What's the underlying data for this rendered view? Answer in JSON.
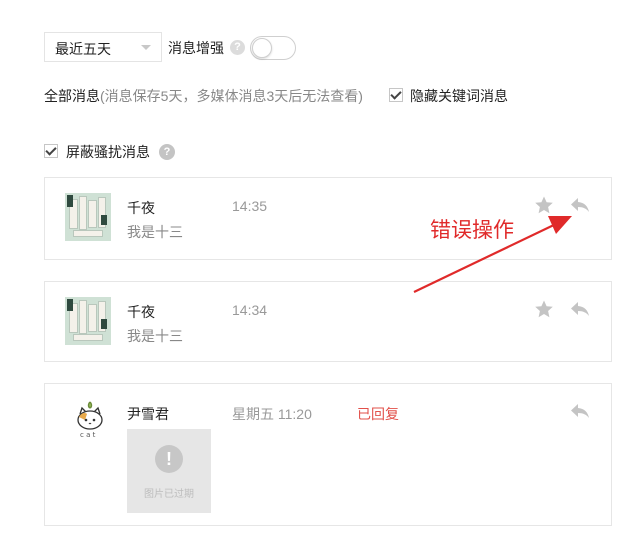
{
  "filter": {
    "selected": "最近五天"
  },
  "enhance": {
    "label": "消息增强",
    "help_glyph": "?"
  },
  "all_messages": {
    "label": "全部消息",
    "note": "(消息保存5天，多媒体消息3天后无法查看)"
  },
  "hide_keyword": {
    "label": "隐藏关键词消息",
    "checked": true
  },
  "block_harass": {
    "label": "屏蔽骚扰消息",
    "checked": true,
    "help_glyph": "?"
  },
  "messages": [
    {
      "sender": "千夜",
      "time": "14:35",
      "content": "我是十三"
    },
    {
      "sender": "千夜",
      "time": "14:34",
      "content": "我是十三"
    },
    {
      "sender": "尹雪君",
      "time": "星期五 11:20",
      "status": "已回复",
      "image_note": "图片已过期",
      "image_glyph": "!"
    }
  ],
  "annotation": {
    "text": "错误操作",
    "color": "#e02a2a"
  },
  "colors": {
    "replied": "#e2504a",
    "muted_text": "#888888",
    "icon_gray": "#c4c4c4"
  }
}
